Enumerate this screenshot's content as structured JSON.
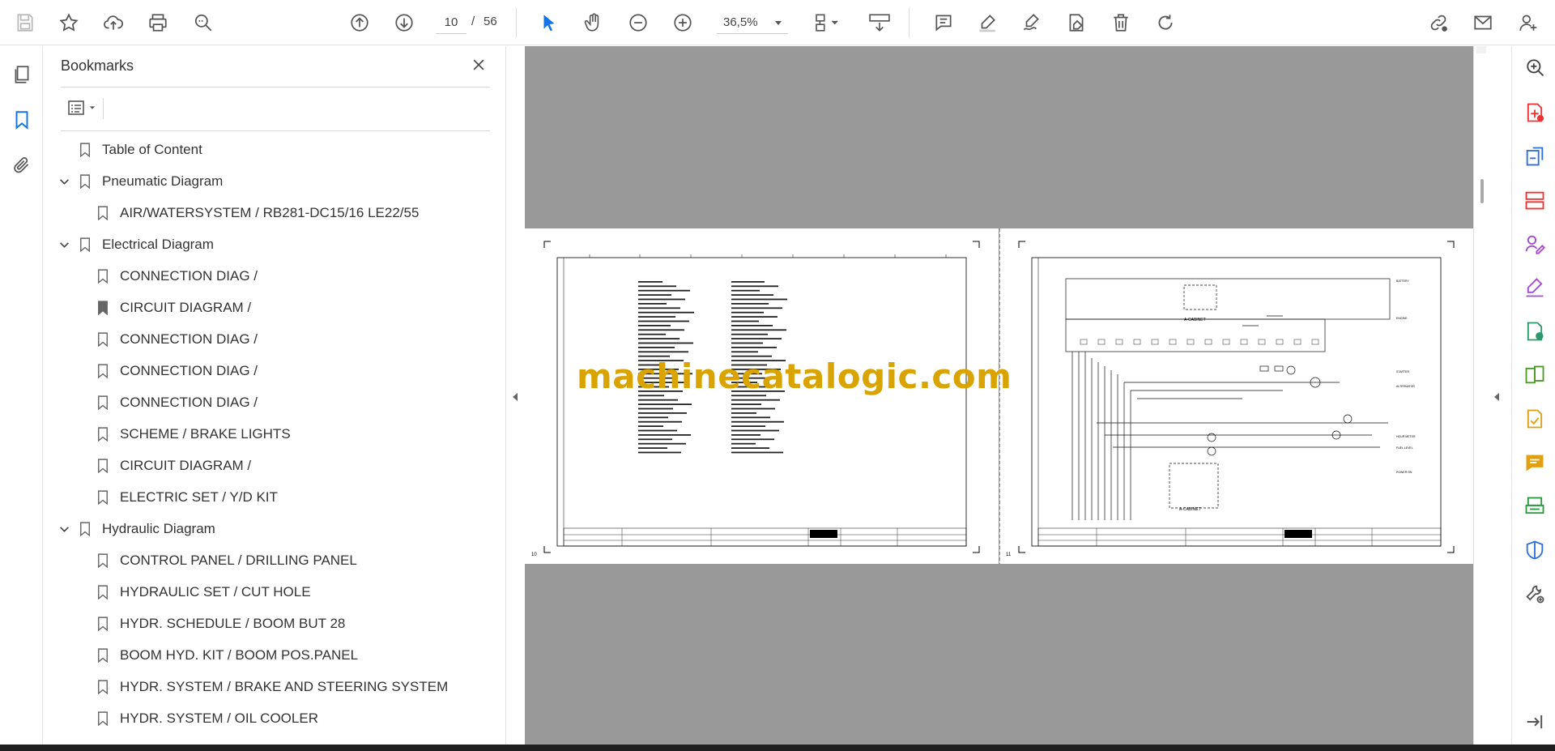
{
  "toolbar": {
    "page_current": "10",
    "page_separator": "/",
    "page_total": "56",
    "zoom": "36,5%",
    "accent_color": "#1473e6"
  },
  "bookmarks": {
    "title": "Bookmarks",
    "items": [
      {
        "label": "Table of Content",
        "level": 0,
        "expandable": false
      },
      {
        "label": "Pneumatic Diagram",
        "level": 0,
        "expandable": true
      },
      {
        "label": "AIR/WATERSYSTEM / RB281-DC15/16 LE22/55",
        "level": 1,
        "expandable": false
      },
      {
        "label": "Electrical Diagram",
        "level": 0,
        "expandable": true
      },
      {
        "label": "CONNECTION DIAG /",
        "level": 1,
        "expandable": false
      },
      {
        "label": "CIRCUIT DIAGRAM /",
        "level": 1,
        "expandable": false,
        "active": true
      },
      {
        "label": "CONNECTION DIAG /",
        "level": 1,
        "expandable": false
      },
      {
        "label": "CONNECTION DIAG /",
        "level": 1,
        "expandable": false
      },
      {
        "label": "CONNECTION DIAG /",
        "level": 1,
        "expandable": false
      },
      {
        "label": "SCHEME / BRAKE LIGHTS",
        "level": 1,
        "expandable": false
      },
      {
        "label": "CIRCUIT DIAGRAM /",
        "level": 1,
        "expandable": false
      },
      {
        "label": "ELECTRIC SET / Y/D KIT",
        "level": 1,
        "expandable": false
      },
      {
        "label": "Hydraulic Diagram",
        "level": 0,
        "expandable": true
      },
      {
        "label": "CONTROL PANEL / DRILLING PANEL",
        "level": 1,
        "expandable": false
      },
      {
        "label": "HYDRAULIC SET / CUT HOLE",
        "level": 1,
        "expandable": false
      },
      {
        "label": "HYDR. SCHEDULE / BOOM BUT 28",
        "level": 1,
        "expandable": false
      },
      {
        "label": "BOOM HYD. KIT / BOOM POS.PANEL",
        "level": 1,
        "expandable": false
      },
      {
        "label": "HYDR. SYSTEM / BRAKE AND STEERING SYSTEM",
        "level": 1,
        "expandable": false
      },
      {
        "label": "HYDR. SYSTEM / OIL COOLER",
        "level": 1,
        "expandable": false
      }
    ]
  },
  "document": {
    "watermark": "machinecatalogic.com",
    "left_page_number": "10",
    "right_page_number": "11",
    "right_labels": [
      "BATTERY",
      "ENGINE",
      "STARTER",
      "ALTERNATOR",
      "HOUR METER",
      "FUEL LEVEL",
      "POWER ON"
    ],
    "cabinet_label": "A-CABINET",
    "watermark_color": "#d9a400"
  }
}
